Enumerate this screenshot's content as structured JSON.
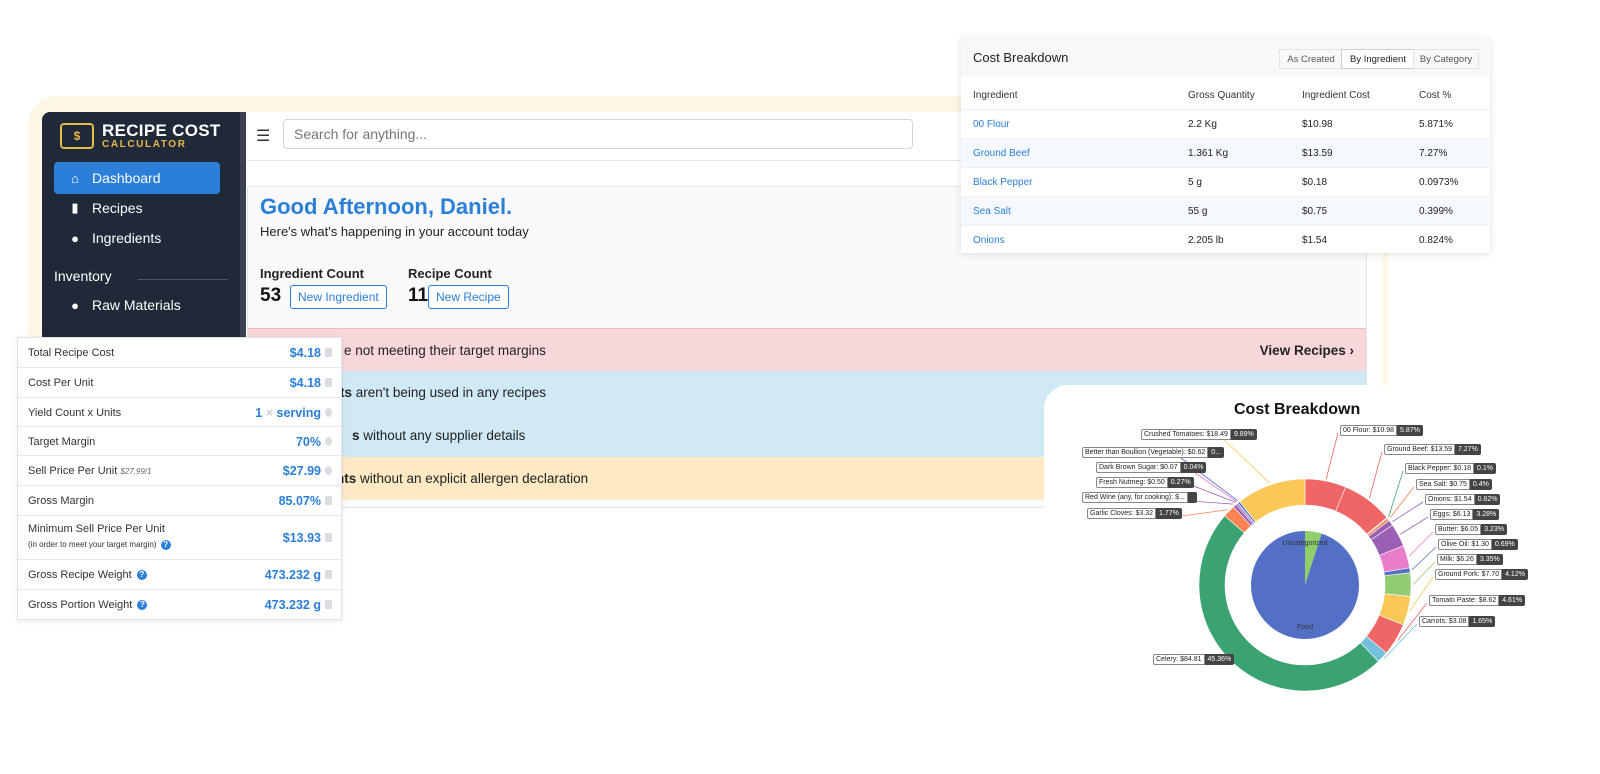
{
  "app": {
    "logo_line1": "RECIPE COST",
    "logo_line2": "CALCULATOR",
    "logo_coin": "$"
  },
  "sidebar": {
    "items": [
      {
        "label": "Dashboard",
        "icon": "home-icon",
        "active": true
      },
      {
        "label": "Recipes",
        "icon": "document-icon",
        "active": false
      },
      {
        "label": "Ingredients",
        "icon": "apple-icon",
        "active": false
      }
    ],
    "section": "Inventory",
    "section_items": [
      {
        "label": "Raw Materials",
        "icon": "apple-icon"
      }
    ]
  },
  "topbar": {
    "menu_icon": "hamburger-icon",
    "search_placeholder": "Search for anything..."
  },
  "dashboard": {
    "greeting": "Good Afternoon, Daniel.",
    "subtitle": "Here's what's happening in your account today",
    "ingredient_count_label": "Ingredient Count",
    "ingredient_count": "53",
    "new_ingredient": "New Ingredient",
    "recipe_count_label": "Recipe Count",
    "recipe_count": "11",
    "new_recipe": "New Recipe",
    "alerts": [
      {
        "bold": "",
        "text": "e not meeting their target margins",
        "color": "#f8d7da",
        "action": "View Recipes"
      },
      {
        "bold": "ts",
        "text": " aren't being used in any recipes",
        "color": "#cfe9f5"
      },
      {
        "bold": "s",
        "text": " without any supplier details",
        "color": "#cfe9f5"
      },
      {
        "bold": "nts",
        "text": " without an explicit allergen declaration",
        "color": "#fde9c4"
      }
    ]
  },
  "cost_table": {
    "title": "Cost Breakdown",
    "tabs": [
      "As Created",
      "By Ingredient",
      "By Category"
    ],
    "active_tab": "By Ingredient",
    "columns": [
      "Ingredient",
      "Gross Quantity",
      "Ingredient Cost",
      "Cost %"
    ],
    "rows": [
      [
        "00 Flour",
        "2.2 Kg",
        "$10.98",
        "5.871%"
      ],
      [
        "Ground Beef",
        "1.361 Kg",
        "$13.59",
        "7.27%"
      ],
      [
        "Black Pepper",
        "5 g",
        "$0.18",
        "0.0973%"
      ],
      [
        "Sea Salt",
        "55 g",
        "$0.75",
        "0.399%"
      ],
      [
        "Onions",
        "2.205 lb",
        "$1.54",
        "0.824%"
      ]
    ]
  },
  "summary": {
    "rows": [
      {
        "label": "Total Recipe Cost",
        "value": "$4.18"
      },
      {
        "label": "Cost Per Unit",
        "value": "$4.18"
      },
      {
        "label": "Yield Count x Units",
        "value": "1",
        "value2": "serving",
        "sep": "×"
      },
      {
        "label": "Target Margin",
        "value": "70%"
      },
      {
        "label": "Sell Price Per Unit",
        "sub": "$27.99/1",
        "value": "$27.99"
      },
      {
        "label": "Gross Margin",
        "value": "85.07%"
      },
      {
        "label": "Minimum Sell Price Per Unit",
        "sub": "(in order to meet your target margin)",
        "value": "$13.93"
      },
      {
        "label": "Gross Recipe Weight",
        "value": "473.232 g"
      },
      {
        "label": "Gross Portion Weight",
        "value": "473.232 g"
      }
    ]
  },
  "chart_data": {
    "type": "pie",
    "title": "Cost Breakdown",
    "inner": [
      {
        "name": "Uncategorized",
        "value": 5,
        "color": "#8fce6a"
      },
      {
        "name": "Food",
        "value": 95,
        "color": "#5470c6"
      }
    ],
    "outer": [
      {
        "label": "00 Flour: $10.98",
        "pct": "5.87%",
        "value": 5.87,
        "color": "#ee6666"
      },
      {
        "label": "Ground Beef: $13.59",
        "pct": "7.27%",
        "value": 7.27,
        "color": "#ee6666"
      },
      {
        "label": "Black Pepper: $0.18",
        "pct": "0.1%",
        "value": 0.1,
        "color": "#3ba272"
      },
      {
        "label": "Sea Salt: $0.75",
        "pct": "0.4%",
        "value": 0.4,
        "color": "#fc8452"
      },
      {
        "label": "Onions: $1.54",
        "pct": "0.82%",
        "value": 0.82,
        "color": "#9a60b4"
      },
      {
        "label": "Eggs: $6.13",
        "pct": "3.28%",
        "value": 3.28,
        "color": "#9a60b4"
      },
      {
        "label": "Butter: $6.05",
        "pct": "3.23%",
        "value": 3.23,
        "color": "#ea7ccc"
      },
      {
        "label": "Olive Oil: $1.30",
        "pct": "0.69%",
        "value": 0.69,
        "color": "#5470c6"
      },
      {
        "label": "Milk: $6.26",
        "pct": "3.35%",
        "value": 3.35,
        "color": "#91cc75"
      },
      {
        "label": "Ground Pork: $7.70",
        "pct": "4.12%",
        "value": 4.12,
        "color": "#fac858"
      },
      {
        "label": "Tomato Paste: $8.62",
        "pct": "4.61%",
        "value": 4.61,
        "color": "#ee6666"
      },
      {
        "label": "Carrots: $3.08",
        "pct": "1.65%",
        "value": 1.65,
        "color": "#73c0de"
      },
      {
        "label": "Celery: $84.81",
        "pct": "45.36%",
        "value": 45.36,
        "color": "#3ba272"
      },
      {
        "label": "Garlic Cloves: $3.32",
        "pct": "1.77%",
        "value": 1.77,
        "color": "#fc8452"
      },
      {
        "label": "Red Wine (any, for cooking): $...",
        "pct": "",
        "value": 0.5,
        "color": "#9a60b4"
      },
      {
        "label": "Fresh Nutmeg: $0.50",
        "pct": "0.27%",
        "value": 0.27,
        "color": "#9a60b4"
      },
      {
        "label": "Dark Brown Sugar: $0.07",
        "pct": "0.04%",
        "value": 0.04,
        "color": "#ea7ccc"
      },
      {
        "label": "Better than Boullion (Vegetable): $0.62",
        "pct": "0...",
        "value": 0.33,
        "color": "#5470c6"
      },
      {
        "label": "Crushed Tomatoes: $18.49",
        "pct": "9.89%",
        "value": 9.89,
        "color": "#fac858"
      }
    ]
  }
}
